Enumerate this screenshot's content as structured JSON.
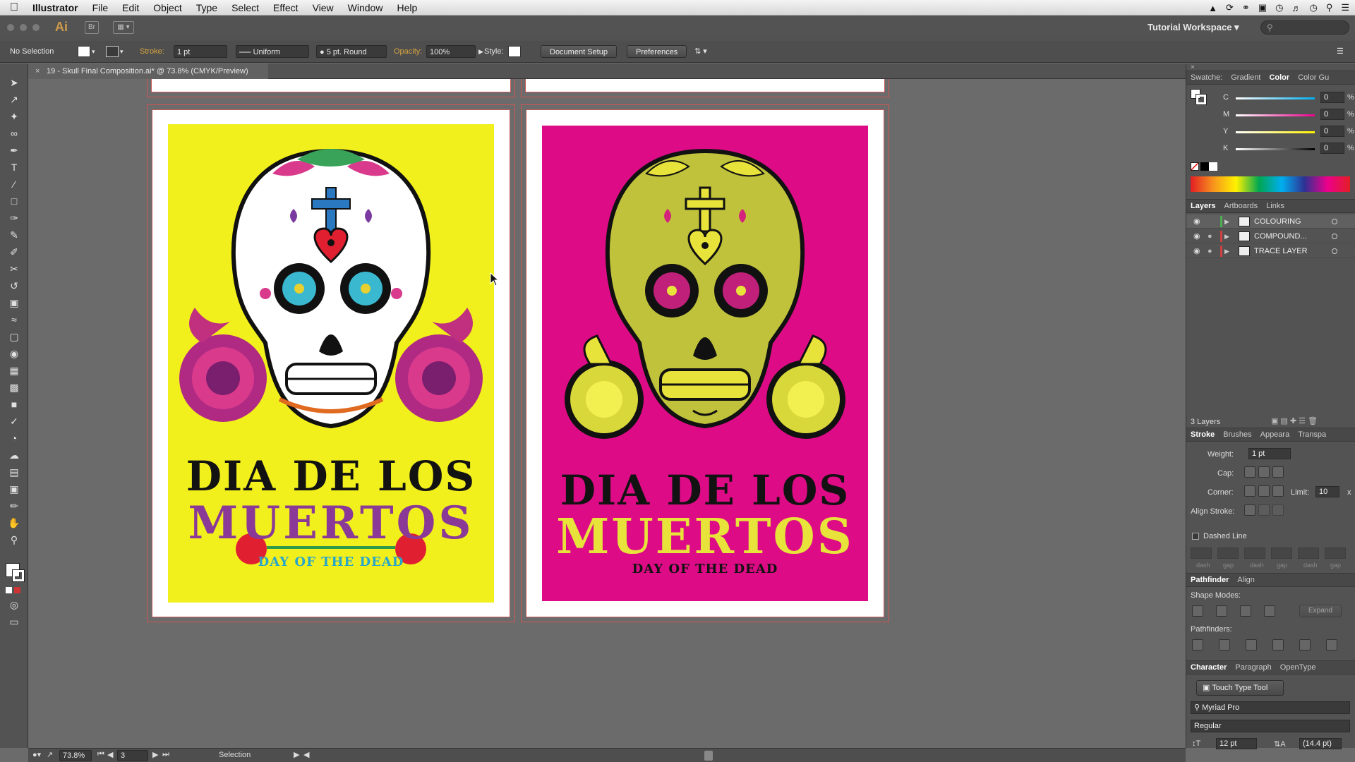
{
  "menubar": {
    "app_name": "Illustrator",
    "items": [
      "File",
      "Edit",
      "Object",
      "Type",
      "Select",
      "Effect",
      "View",
      "Window",
      "Help"
    ]
  },
  "appbar": {
    "logo": "Ai",
    "bridge": "Br",
    "workspace": "Tutorial Workspace"
  },
  "controlbar": {
    "selection": "No Selection",
    "stroke_label": "Stroke:",
    "stroke_value": "1 pt",
    "profile": "Uniform",
    "brush": "5 pt. Round",
    "opacity_label": "Opacity:",
    "opacity_value": "100%",
    "style_label": "Style:",
    "document_setup": "Document Setup",
    "preferences": "Preferences"
  },
  "document": {
    "tab_title": "19 - Skull Final Composition.ai* @ 73.8% (CMYK/Preview)"
  },
  "posters": {
    "left": {
      "line1": "DIA DE LOS",
      "line2": "MUERTOS",
      "line3": "DAY OF THE DEAD",
      "bg": "#f2f01c",
      "title_color": "#121212",
      "accent_color": "#8a3a96",
      "banner_color": "#2aa6c9"
    },
    "right": {
      "line1": "DIA DE LOS",
      "line2": "MUERTOS",
      "line3": "DAY OF THE DEAD",
      "bg": "#dd0c86",
      "title_color": "#121212",
      "accent_color": "#e8e33a"
    }
  },
  "color_panel": {
    "tabs": [
      "Swatche:",
      "Gradient",
      "Color",
      "Color Gu"
    ],
    "active_tab": "Color",
    "channels": [
      {
        "label": "C",
        "value": "0",
        "unit": "%"
      },
      {
        "label": "M",
        "value": "0",
        "unit": "%"
      },
      {
        "label": "Y",
        "value": "0",
        "unit": "%"
      },
      {
        "label": "K",
        "value": "0",
        "unit": "%"
      }
    ]
  },
  "layers_panel": {
    "tabs": [
      "Layers",
      "Artboards",
      "Links"
    ],
    "active_tab": "Layers",
    "layers": [
      {
        "name": "COLOURING",
        "color": "#4caf50"
      },
      {
        "name": "COMPOUND...",
        "color": "#d04040"
      },
      {
        "name": "TRACE LAYER",
        "color": "#d04040"
      }
    ],
    "count": "3 Layers"
  },
  "stroke_panel": {
    "tabs": [
      "Stroke",
      "Brushes",
      "Appeara",
      "Transpa"
    ],
    "active_tab": "Stroke",
    "weight_label": "Weight:",
    "weight_value": "1 pt",
    "cap_label": "Cap:",
    "corner_label": "Corner:",
    "limit_label": "Limit:",
    "limit_value": "10",
    "limit_unit": "x",
    "align_label": "Align Stroke:",
    "dashed_label": "Dashed Line",
    "dash_labels": [
      "dash",
      "gap",
      "dash",
      "gap",
      "dash",
      "gap"
    ]
  },
  "pathfinder_panel": {
    "tabs": [
      "Pathfinder",
      "Align"
    ],
    "active_tab": "Pathfinder",
    "shape_modes": "Shape Modes:",
    "expand": "Expand",
    "pathfinders": "Pathfinders:"
  },
  "character_panel": {
    "tabs": [
      "Character",
      "Paragraph",
      "OpenType"
    ],
    "active_tab": "Character",
    "touch_type": "Touch Type Tool",
    "font": "Myriad Pro",
    "style": "Regular",
    "size": "12 pt",
    "leading": "(14.4 pt)"
  },
  "statusbar": {
    "zoom": "73.8%",
    "artboard": "3",
    "tool": "Selection"
  }
}
